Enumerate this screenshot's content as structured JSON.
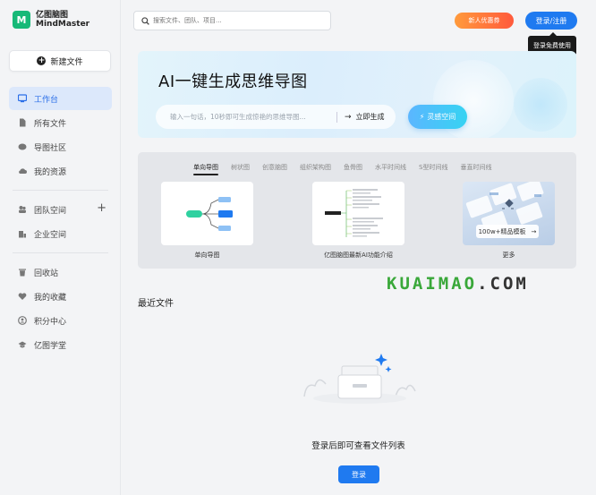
{
  "app": {
    "logo_cn": "亿图脑图",
    "logo_en": "MindMaster",
    "logo_mark": "M"
  },
  "sidebar": {
    "new_file": "新建文件",
    "group1": [
      {
        "label": "工作台",
        "icon": "workspace-icon",
        "active": true
      },
      {
        "label": "所有文件",
        "icon": "file-icon"
      },
      {
        "label": "导图社区",
        "icon": "community-icon"
      },
      {
        "label": "我的资源",
        "icon": "cloud-icon"
      }
    ],
    "group2": [
      {
        "label": "团队空间",
        "icon": "team-icon"
      },
      {
        "label": "企业空间",
        "icon": "enterprise-icon"
      }
    ],
    "group3": [
      {
        "label": "回收站",
        "icon": "trash-icon"
      },
      {
        "label": "我的收藏",
        "icon": "heart-icon"
      },
      {
        "label": "积分中心",
        "icon": "points-icon"
      },
      {
        "label": "亿图学堂",
        "icon": "academy-icon"
      }
    ]
  },
  "topbar": {
    "search_placeholder": "搜索文件、团队、项目...",
    "promo": "新人优惠券",
    "login": "登录/注册",
    "tooltip": "登录免费使用"
  },
  "hero": {
    "title": "AI一键生成思维导图",
    "input_placeholder": "输入一句话，10秒即可生成惊艳的思维导图...",
    "generate": "立即生成",
    "ai_space": "灵感空间"
  },
  "templates": {
    "tabs": [
      "单向导图",
      "树状图",
      "创意脑图",
      "组织架构图",
      "鱼骨图",
      "水平时间线",
      "S型时间线",
      "垂直时间线"
    ],
    "cards": [
      {
        "label": "单向导图"
      },
      {
        "label": "亿图脑图最新AI功能介绍"
      },
      {
        "label": "更多",
        "tag": "100w+精品模板"
      }
    ]
  },
  "watermark": {
    "part1": "KUAIMAO",
    "part2": ".COM"
  },
  "recent": {
    "title": "最近文件",
    "empty_text": "登录后即可查看文件列表",
    "login": "登录"
  },
  "colors": {
    "accent": "#1f7af0",
    "brand": "#17b978",
    "active_nav_bg": "#dce8fb"
  }
}
